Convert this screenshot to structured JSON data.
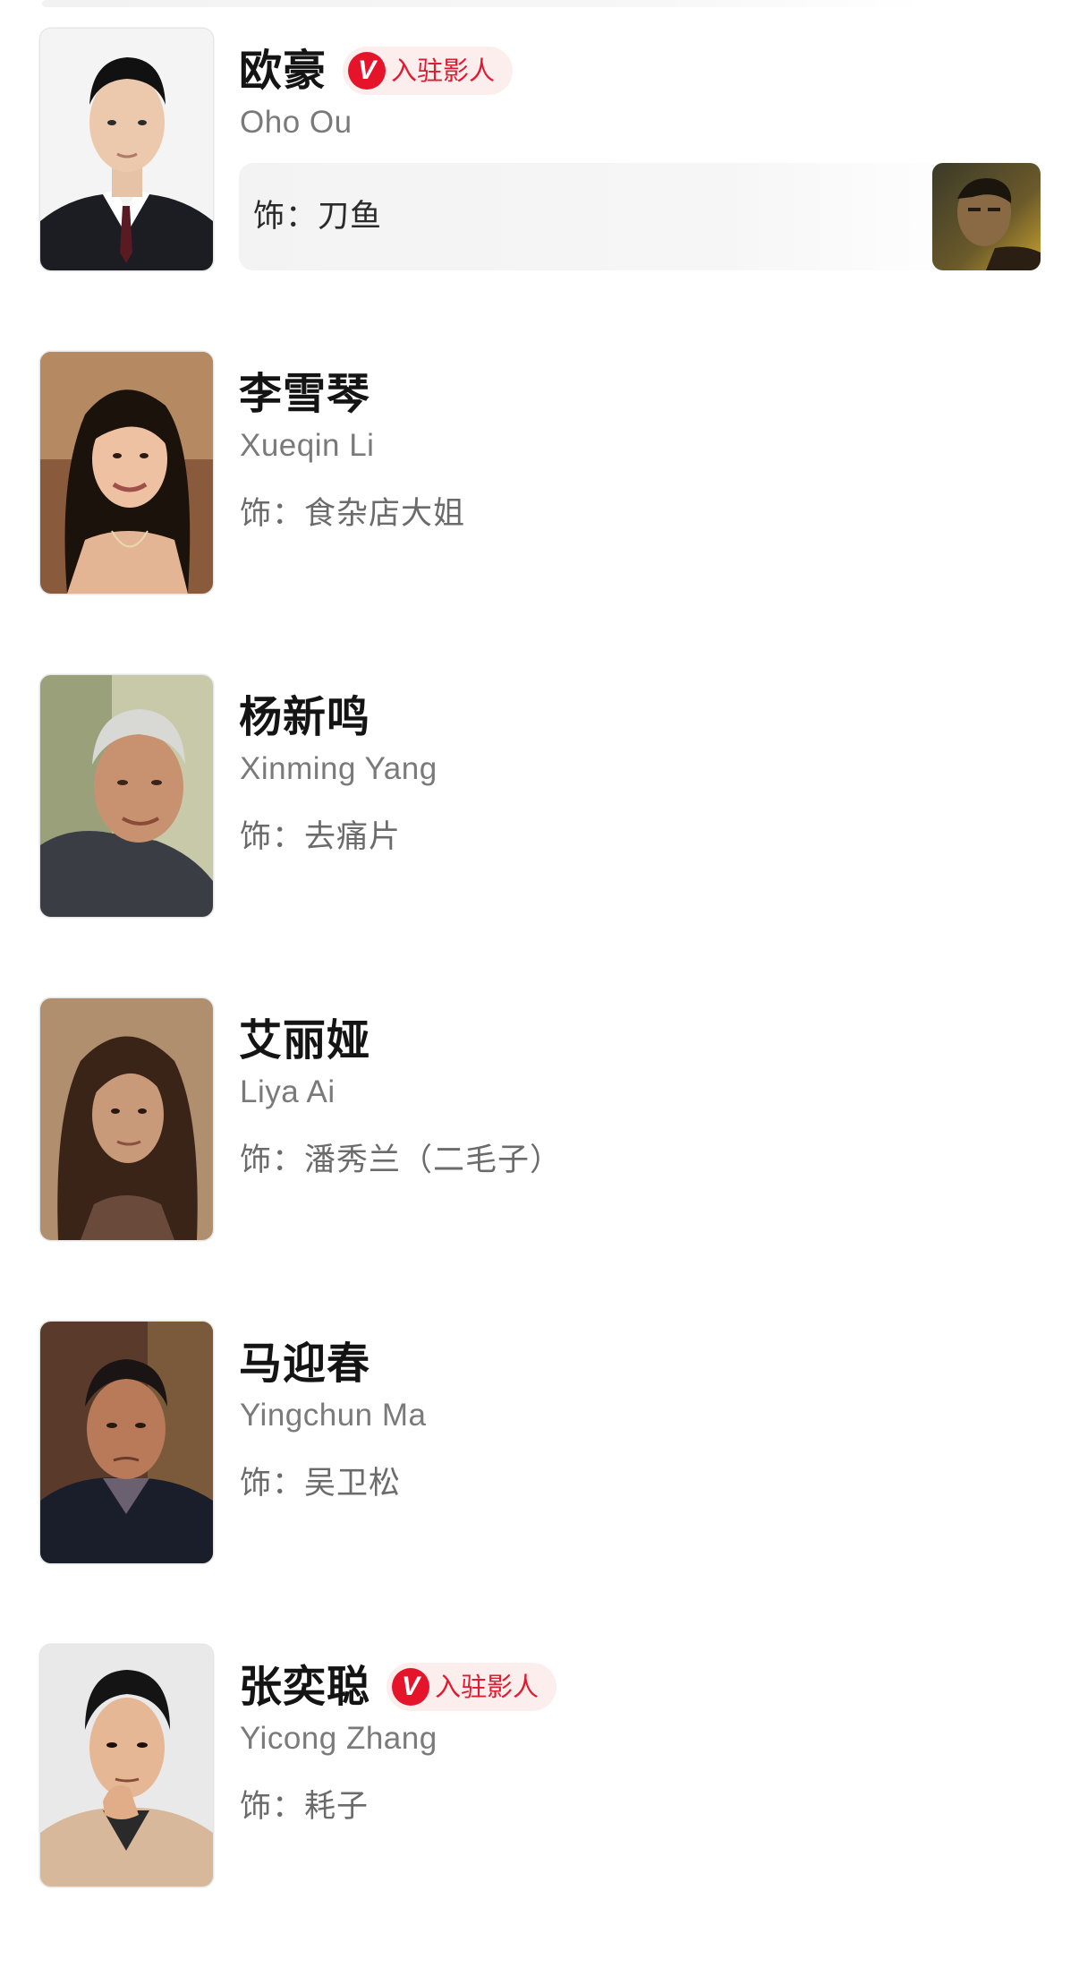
{
  "cast": [
    {
      "name_cn": "欧豪",
      "name_en": "Oho Ou",
      "verified": true,
      "badge_icon": "V",
      "badge_label": "入驻影人",
      "role": "饰：刀鱼",
      "has_still": true
    },
    {
      "name_cn": "李雪琴",
      "name_en": "Xueqin Li",
      "verified": false,
      "role": "饰：食杂店大姐"
    },
    {
      "name_cn": "杨新鸣",
      "name_en": "Xinming Yang",
      "verified": false,
      "role": "饰：去痛片"
    },
    {
      "name_cn": "艾丽娅",
      "name_en": "Liya Ai",
      "verified": false,
      "role": "饰：潘秀兰（二毛子）"
    },
    {
      "name_cn": "马迎春",
      "name_en": "Yingchun Ma",
      "verified": false,
      "role": "饰：吴卫松"
    },
    {
      "name_cn": "张奕聪",
      "name_en": "Yicong Zhang",
      "verified": true,
      "badge_icon": "V",
      "badge_label": "入驻影人",
      "role": "饰：耗子"
    }
  ],
  "colors": {
    "badge_red": "#e5142b",
    "badge_bg": "#fdeeee",
    "name": "#141414",
    "secondary": "#7a7a7a"
  }
}
